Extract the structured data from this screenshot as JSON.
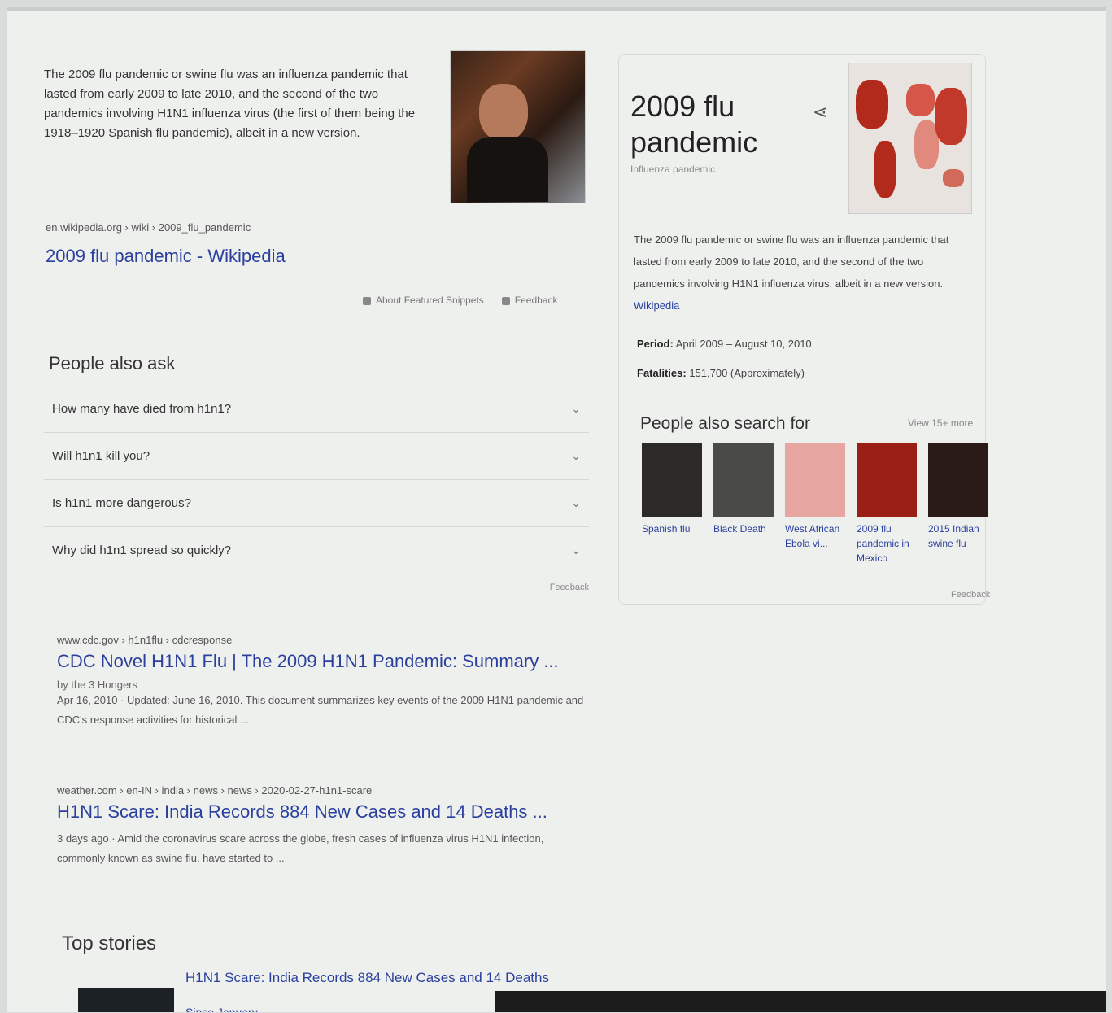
{
  "featured_snippet": {
    "text": "The 2009 flu pandemic or swine flu was an influenza pandemic that lasted from early 2009 to late 2010, and the second of the two pandemics involving H1N1 influenza virus (the first of them being the 1918–1920 Spanish flu pandemic), albeit in a new version.",
    "cite": "en.wikipedia.org › wiki › 2009_flu_pandemic",
    "title": "2009 flu pandemic - Wikipedia",
    "about_label": "About Featured Snippets",
    "feedback_label": "Feedback"
  },
  "people_also_ask": {
    "title": "People also ask",
    "questions": [
      "How many have died from h1n1?",
      "Will h1n1 kill you?",
      "Is h1n1 more dangerous?",
      "Why did h1n1 spread so quickly?"
    ],
    "feedback_label": "Feedback"
  },
  "results": [
    {
      "cite": "www.cdc.gov › h1n1flu › cdcresponse",
      "title": "CDC Novel H1N1 Flu | The 2009 H1N1 Pandemic: Summary ...",
      "meta": "by the 3 Hongers",
      "desc": "Apr 16, 2010 · Updated: June 16, 2010. This document summarizes key events of the 2009 H1N1 pandemic and CDC's response activities for historical ..."
    },
    {
      "cite": "weather.com › en-IN › india › news › news › 2020-02-27-h1n1-scare",
      "title": "H1N1 Scare: India Records 884 New Cases and 14 Deaths ...",
      "meta": "",
      "desc": "3 days ago · Amid the coronavirus scare across the globe, fresh cases of influenza virus H1N1 infection, commonly known as swine flu, have started to ..."
    }
  ],
  "top_stories": {
    "title": "Top stories",
    "story_title": "H1N1 Scare: India Records 884 New Cases and 14 Deaths",
    "story_sub": "Since January"
  },
  "knowledge_panel": {
    "title": "2009 flu pandemic",
    "subtitle": "Influenza pandemic",
    "description": "The 2009 flu pandemic or swine flu was an influenza pandemic that lasted from early 2009 to late 2010, and the second of the two pandemics involving H1N1 influenza virus, albeit in a new version.",
    "source": "Wikipedia",
    "facts": [
      {
        "label": "Period:",
        "value": "April 2009 – August 10, 2010"
      },
      {
        "label": "Fatalities:",
        "value": "151,700 (Approximately)"
      }
    ],
    "people_also_search_title": "People also search for",
    "view_more": "View 15+ more",
    "cards": [
      {
        "label": "Spanish flu",
        "color": "#2b2a27"
      },
      {
        "label": "Black Death",
        "color": "#4a4a48"
      },
      {
        "label": "West African Ebola vi...",
        "color": "#e8a6a0"
      },
      {
        "label": "2009 flu pandemic in Mexico",
        "color": "#9b1f14"
      },
      {
        "label": "2015 Indian swine flu",
        "color": "#2a1a18"
      }
    ],
    "feedback_label": "Feedback"
  }
}
